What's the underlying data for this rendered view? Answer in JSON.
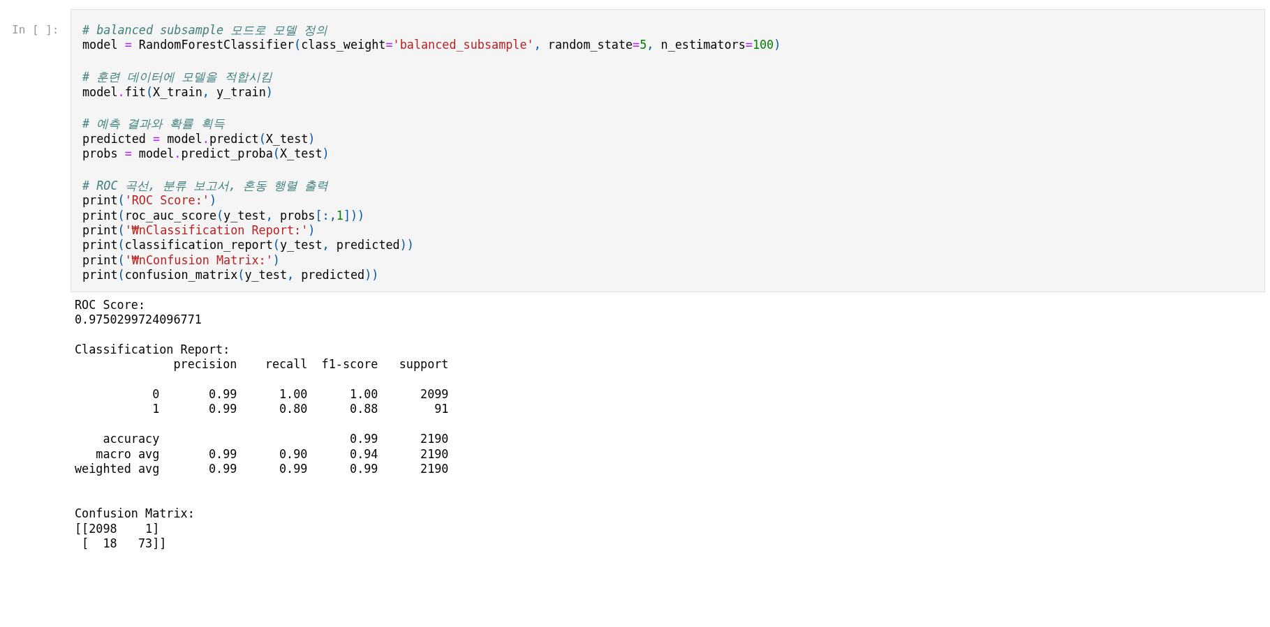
{
  "cell": {
    "prompt": "In [ ]:",
    "code_blocks": [
      [
        [
          {
            "kind": "com",
            "s": "# balanced subsample 모드로 모델 정의"
          }
        ],
        [
          {
            "kind": "txt",
            "s": "model "
          },
          {
            "kind": "op",
            "s": "="
          },
          {
            "kind": "txt",
            "s": " RandomForestClassifier"
          },
          {
            "kind": "pun",
            "s": "("
          },
          {
            "kind": "txt",
            "s": "class_weight"
          },
          {
            "kind": "op",
            "s": "="
          },
          {
            "kind": "str",
            "s": "'balanced_subsample'"
          },
          {
            "kind": "pun",
            "s": ","
          },
          {
            "kind": "txt",
            "s": " random_state"
          },
          {
            "kind": "op",
            "s": "="
          },
          {
            "kind": "num",
            "s": "5"
          },
          {
            "kind": "pun",
            "s": ","
          },
          {
            "kind": "txt",
            "s": " n_estimators"
          },
          {
            "kind": "op",
            "s": "="
          },
          {
            "kind": "num",
            "s": "100"
          },
          {
            "kind": "pun",
            "s": ")"
          }
        ]
      ],
      [
        [
          {
            "kind": "com",
            "s": "# 훈련 데이터에 모델을 적합시킴"
          }
        ],
        [
          {
            "kind": "txt",
            "s": "model"
          },
          {
            "kind": "op",
            "s": "."
          },
          {
            "kind": "txt",
            "s": "fit"
          },
          {
            "kind": "pun",
            "s": "("
          },
          {
            "kind": "txt",
            "s": "X_train"
          },
          {
            "kind": "pun",
            "s": ","
          },
          {
            "kind": "txt",
            "s": " y_train"
          },
          {
            "kind": "pun",
            "s": ")"
          }
        ]
      ],
      [
        [
          {
            "kind": "com",
            "s": "# 예측 결과와 확률 획득"
          }
        ],
        [
          {
            "kind": "txt",
            "s": "predicted "
          },
          {
            "kind": "op",
            "s": "="
          },
          {
            "kind": "txt",
            "s": " model"
          },
          {
            "kind": "op",
            "s": "."
          },
          {
            "kind": "txt",
            "s": "predict"
          },
          {
            "kind": "pun",
            "s": "("
          },
          {
            "kind": "txt",
            "s": "X_test"
          },
          {
            "kind": "pun",
            "s": ")"
          }
        ],
        [
          {
            "kind": "txt",
            "s": "probs "
          },
          {
            "kind": "op",
            "s": "="
          },
          {
            "kind": "txt",
            "s": " model"
          },
          {
            "kind": "op",
            "s": "."
          },
          {
            "kind": "txt",
            "s": "predict_proba"
          },
          {
            "kind": "pun",
            "s": "("
          },
          {
            "kind": "txt",
            "s": "X_test"
          },
          {
            "kind": "pun",
            "s": ")"
          }
        ]
      ],
      [
        [
          {
            "kind": "com",
            "s": "# ROC 곡선, 분류 보고서, 혼동 행렬 출력"
          }
        ],
        [
          {
            "kind": "txt",
            "s": "print"
          },
          {
            "kind": "pun",
            "s": "("
          },
          {
            "kind": "str",
            "s": "'ROC Score:'"
          },
          {
            "kind": "pun",
            "s": ")"
          }
        ],
        [
          {
            "kind": "txt",
            "s": "print"
          },
          {
            "kind": "pun",
            "s": "("
          },
          {
            "kind": "txt",
            "s": "roc_auc_score"
          },
          {
            "kind": "pun",
            "s": "("
          },
          {
            "kind": "txt",
            "s": "y_test"
          },
          {
            "kind": "pun",
            "s": ","
          },
          {
            "kind": "txt",
            "s": " probs"
          },
          {
            "kind": "pun",
            "s": "[:,"
          },
          {
            "kind": "num",
            "s": "1"
          },
          {
            "kind": "pun",
            "s": "]))"
          }
        ],
        [
          {
            "kind": "txt",
            "s": "print"
          },
          {
            "kind": "pun",
            "s": "("
          },
          {
            "kind": "str",
            "s": "'₩nClassification Report:'"
          },
          {
            "kind": "pun",
            "s": ")"
          }
        ],
        [
          {
            "kind": "txt",
            "s": "print"
          },
          {
            "kind": "pun",
            "s": "("
          },
          {
            "kind": "txt",
            "s": "classification_report"
          },
          {
            "kind": "pun",
            "s": "("
          },
          {
            "kind": "txt",
            "s": "y_test"
          },
          {
            "kind": "pun",
            "s": ","
          },
          {
            "kind": "txt",
            "s": " predicted"
          },
          {
            "kind": "pun",
            "s": "))"
          }
        ],
        [
          {
            "kind": "txt",
            "s": "print"
          },
          {
            "kind": "pun",
            "s": "("
          },
          {
            "kind": "str",
            "s": "'₩nConfusion Matrix:'"
          },
          {
            "kind": "pun",
            "s": ")"
          }
        ],
        [
          {
            "kind": "txt",
            "s": "print"
          },
          {
            "kind": "pun",
            "s": "("
          },
          {
            "kind": "txt",
            "s": "confusion_matrix"
          },
          {
            "kind": "pun",
            "s": "("
          },
          {
            "kind": "txt",
            "s": "y_test"
          },
          {
            "kind": "pun",
            "s": ","
          },
          {
            "kind": "txt",
            "s": " predicted"
          },
          {
            "kind": "pun",
            "s": "))"
          }
        ]
      ]
    ],
    "output": "ROC Score:\n0.9750299724096771\n\nClassification Report:\n              precision    recall  f1-score   support\n\n           0       0.99      1.00      1.00      2099\n           1       0.99      0.80      0.88        91\n\n    accuracy                           0.99      2190\n   macro avg       0.99      0.90      0.94      2190\nweighted avg       0.99      0.99      0.99      2190\n\n\nConfusion Matrix:\n[[2098    1]\n [  18   73]]"
  }
}
